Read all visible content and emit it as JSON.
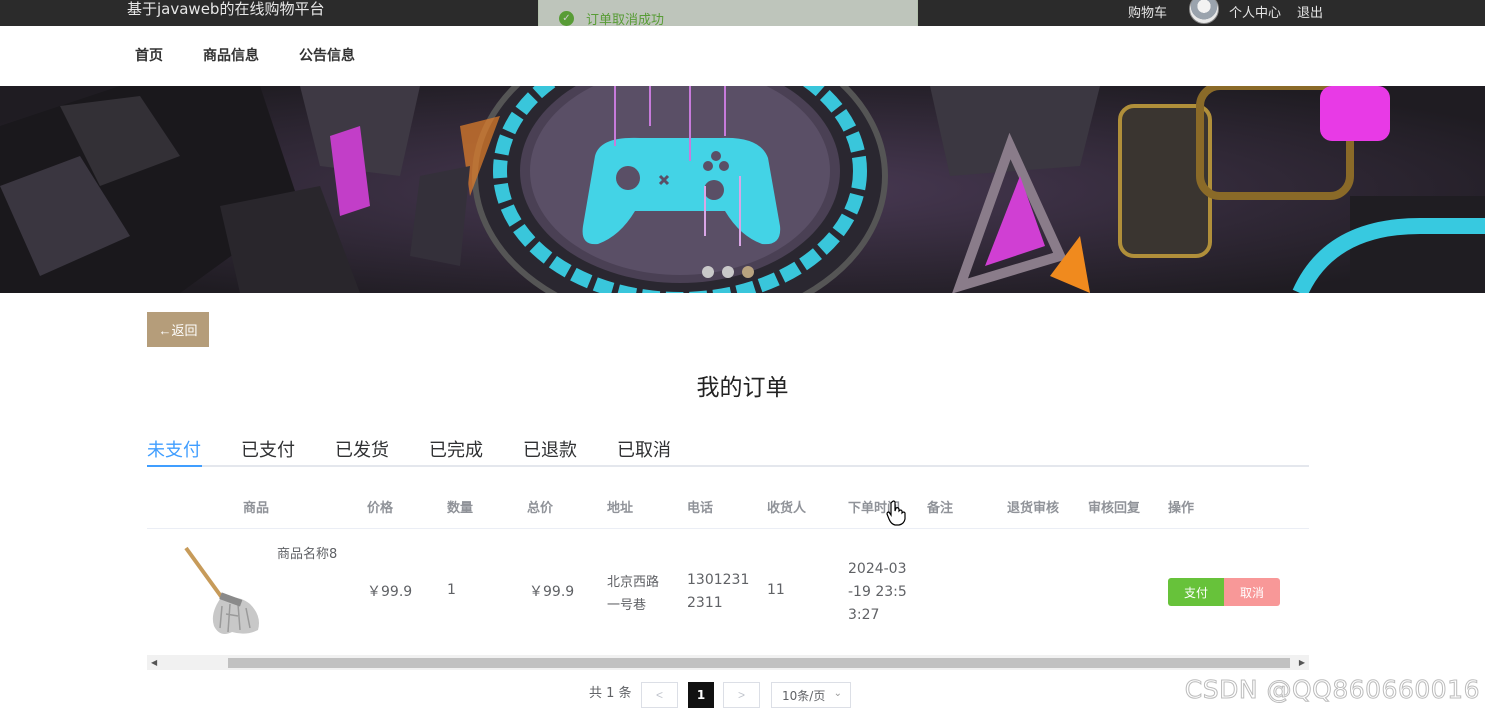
{
  "header": {
    "site_title": "基于javaweb的在线购物平台",
    "cart_label": "购物车",
    "profile_label": "个人中心",
    "logout_label": "退出"
  },
  "toast": {
    "message": "订单取消成功"
  },
  "nav": {
    "items": [
      "首页",
      "商品信息",
      "公告信息"
    ]
  },
  "banner": {
    "dots": 3,
    "active_dot_index": 2
  },
  "back_button": "←返回",
  "page_title": "我的订单",
  "tabs": [
    "未支付",
    "已支付",
    "已发货",
    "已完成",
    "已退款",
    "已取消"
  ],
  "active_tab": "未支付",
  "table": {
    "headers": [
      "商品",
      "价格",
      "数量",
      "总价",
      "地址",
      "电话",
      "收货人",
      "下单时间",
      "备注",
      "退货审核",
      "审核回复",
      "操作"
    ],
    "rows": [
      {
        "product_name": "商品名称8",
        "price": "￥99.9",
        "quantity": "1",
        "total": "￥99.9",
        "address_line1": "北京西路",
        "address_line2": "一号巷",
        "phone_line1": "1301231",
        "phone_line2": "2311",
        "receiver": "11",
        "time_line1": "2024-03",
        "time_line2": "-19 23:5",
        "time_line3": "3:27",
        "pay_label": "支付",
        "cancel_label": "取消"
      }
    ]
  },
  "pagination": {
    "total_text": "共 1 条",
    "prev": "<",
    "current_page": "1",
    "next": ">",
    "page_size": "10条/页"
  },
  "watermark": "CSDN @QQ860660016",
  "colors": {
    "accent": "#409eff",
    "back_button": "#b59d7a",
    "pay": "#67c23a",
    "cancel": "#f89898"
  }
}
